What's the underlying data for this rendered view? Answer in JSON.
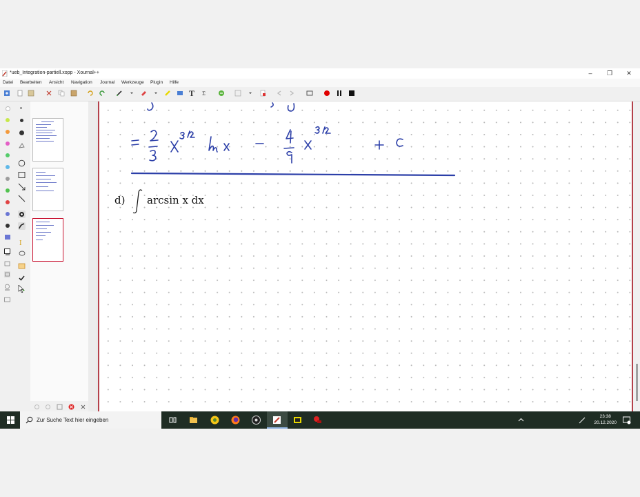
{
  "window": {
    "title": "*ueb_Integration-partiell.xopp - Xournal++",
    "minimize_icon": "minimize-icon",
    "maximize_icon": "restore-icon",
    "close_icon": "close-icon"
  },
  "menu": [
    "Datei",
    "Bearbeiten",
    "Ansicht",
    "Navigation",
    "Journal",
    "Werkzeuge",
    "Plugin",
    "Hilfe"
  ],
  "colors": {
    "ink_blue": "#2c3fa8",
    "page_border": "#b4404a",
    "taskbar": "#1f2d24",
    "record_red": "#e00000"
  },
  "palette": [
    "#ffffff",
    "#c7e84a",
    "#f39a3c",
    "#e45fc6",
    "#54cc6a",
    "#5fb8e8",
    "#9c9c9c",
    "#51c24f",
    "#e04343",
    "#6a76d4",
    "#333333",
    "#6a76d4"
  ],
  "canvas": {
    "task_label": "d)",
    "task_formula": "arcsin x dx",
    "handwriting": "= 2/3 x^{3/2} ln x − 4/9 x^{3/2} + C"
  },
  "page_preview": {
    "pages": 3,
    "selected_page": 3
  },
  "taskbar": {
    "search_placeholder": "Zur Suche Text hier eingeben",
    "time": "23:38",
    "date": "20.12.2020"
  }
}
